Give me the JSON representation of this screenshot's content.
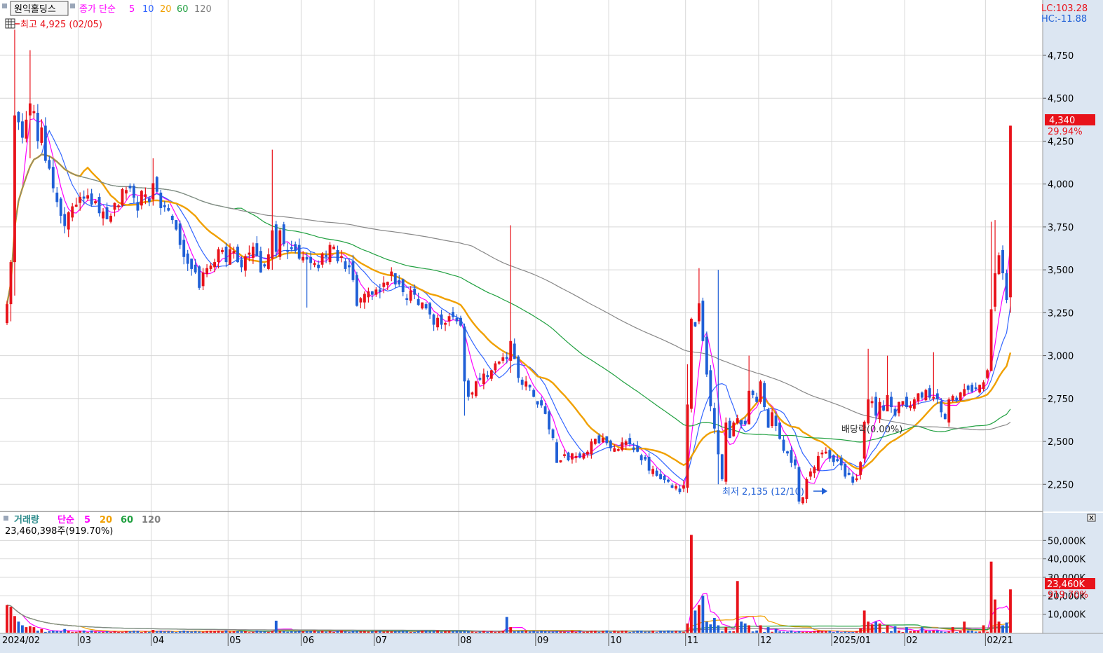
{
  "price_legend": {
    "stock_name": "원익홀딩스",
    "series_label": "종가 단순",
    "ma": [
      {
        "label": "5",
        "color": "#ff00ff"
      },
      {
        "label": "10",
        "color": "#3366ff"
      },
      {
        "label": "20",
        "color": "#f0a000"
      },
      {
        "label": "60",
        "color": "#20a040"
      },
      {
        "label": "120",
        "color": "#808080"
      }
    ],
    "high_note": "최고 4,925 (02/05)",
    "low_note": "최저 2,135 (12/10)",
    "dividend_note": "배당락(0.00%)"
  },
  "corner": {
    "lc": "LC:103.28",
    "hc": "HC:-11.88"
  },
  "last_price": {
    "value": "4,340",
    "change": "29.94%"
  },
  "volume_legend": {
    "title": "거래량",
    "series_label": "단순",
    "ma": [
      {
        "label": "5",
        "color": "#ff00ff"
      },
      {
        "label": "20",
        "color": "#f0a000"
      },
      {
        "label": "60",
        "color": "#20a040"
      },
      {
        "label": "120",
        "color": "#808080"
      }
    ],
    "total": "23,460,398주(919.70%)"
  },
  "last_volume": {
    "value": "23,460K",
    "change": "919.70%"
  },
  "colors": {
    "up": "#e8121a",
    "down": "#1f5fd6",
    "axis_bg": "#dce6f2",
    "grid": "#d8d8d8"
  },
  "chart_data": [
    {
      "type": "candlestick",
      "title": "",
      "ylim": [
        2100,
        4950
      ],
      "yticks": [
        2250,
        2500,
        2750,
        3000,
        3250,
        3500,
        3750,
        4000,
        4250,
        4500,
        4750
      ],
      "ytick_labels": [
        "2,250",
        "2,500",
        "2,750",
        "3,000",
        "3,250",
        "3,500",
        "3,750",
        "4,000",
        "4,250",
        "4,500",
        "4,750"
      ],
      "x_labels": [
        "2024/02",
        "03",
        "04",
        "05",
        "06",
        "07",
        "08",
        "09",
        "10",
        "11",
        "12",
        "2025/01",
        "02",
        "02/21"
      ],
      "x_label_index": [
        0,
        19,
        38,
        58,
        77,
        96,
        118,
        138,
        157,
        177,
        196,
        215,
        234,
        255
      ],
      "anchors_close": [
        [
          0,
          3300
        ],
        [
          1,
          3550
        ],
        [
          2,
          4450
        ],
        [
          4,
          4300
        ],
        [
          6,
          4500
        ],
        [
          7,
          4400
        ],
        [
          8,
          4300
        ],
        [
          9,
          4380
        ],
        [
          10,
          4150
        ],
        [
          12,
          4000
        ],
        [
          14,
          3800
        ],
        [
          15,
          3780
        ],
        [
          17,
          3880
        ],
        [
          19,
          3880
        ],
        [
          20,
          3930
        ],
        [
          21,
          3950
        ],
        [
          23,
          3870
        ],
        [
          25,
          3830
        ],
        [
          27,
          3800
        ],
        [
          28,
          3880
        ],
        [
          31,
          3950
        ],
        [
          33,
          3920
        ],
        [
          34,
          3880
        ],
        [
          35,
          3920
        ],
        [
          37,
          3900
        ],
        [
          38,
          4000
        ],
        [
          39,
          3980
        ],
        [
          40,
          3900
        ],
        [
          42,
          3870
        ],
        [
          43,
          3800
        ],
        [
          45,
          3670
        ],
        [
          46,
          3550
        ],
        [
          48,
          3500
        ],
        [
          50,
          3430
        ],
        [
          52,
          3500
        ],
        [
          54,
          3580
        ],
        [
          56,
          3600
        ],
        [
          57,
          3580
        ],
        [
          59,
          3600
        ],
        [
          61,
          3550
        ],
        [
          62,
          3570
        ],
        [
          64,
          3600
        ],
        [
          65,
          3540
        ],
        [
          67,
          3500
        ],
        [
          68,
          3620
        ],
        [
          69,
          3700
        ],
        [
          70,
          3650
        ],
        [
          71,
          3720
        ],
        [
          72,
          3670
        ],
        [
          74,
          3600
        ],
        [
          76,
          3560
        ],
        [
          78,
          3520
        ],
        [
          80,
          3530
        ],
        [
          82,
          3560
        ],
        [
          84,
          3640
        ],
        [
          85,
          3620
        ],
        [
          86,
          3580
        ],
        [
          88,
          3520
        ],
        [
          90,
          3450
        ],
        [
          91,
          3300
        ],
        [
          92,
          3320
        ],
        [
          94,
          3400
        ],
        [
          96,
          3370
        ],
        [
          98,
          3420
        ],
        [
          100,
          3460
        ],
        [
          101,
          3420
        ],
        [
          102,
          3380
        ],
        [
          104,
          3360
        ],
        [
          106,
          3350
        ],
        [
          108,
          3320
        ],
        [
          110,
          3230
        ],
        [
          112,
          3200
        ],
        [
          114,
          3200
        ],
        [
          116,
          3230
        ],
        [
          118,
          3160
        ],
        [
          119,
          2850
        ],
        [
          120,
          2780
        ],
        [
          122,
          2820
        ],
        [
          124,
          2880
        ],
        [
          126,
          2930
        ],
        [
          128,
          2970
        ],
        [
          130,
          3000
        ],
        [
          131,
          3100
        ],
        [
          132,
          2950
        ],
        [
          134,
          2850
        ],
        [
          136,
          2820
        ],
        [
          137,
          2760
        ],
        [
          138,
          2720
        ],
        [
          140,
          2650
        ],
        [
          142,
          2500
        ],
        [
          143,
          2400
        ],
        [
          145,
          2420
        ],
        [
          147,
          2400
        ],
        [
          149,
          2420
        ],
        [
          151,
          2450
        ],
        [
          153,
          2500
        ],
        [
          155,
          2520
        ],
        [
          157,
          2460
        ],
        [
          159,
          2480
        ],
        [
          161,
          2470
        ],
        [
          163,
          2450
        ],
        [
          165,
          2400
        ],
        [
          167,
          2350
        ],
        [
          169,
          2300
        ],
        [
          171,
          2260
        ],
        [
          173,
          2240
        ],
        [
          175,
          2230
        ],
        [
          176,
          2220
        ],
        [
          177,
          2700
        ],
        [
          178,
          3200
        ],
        [
          179,
          3150
        ],
        [
          180,
          3300
        ],
        [
          181,
          3100
        ],
        [
          182,
          2900
        ],
        [
          183,
          2700
        ],
        [
          184,
          2600
        ],
        [
          185,
          2400
        ],
        [
          186,
          2300
        ],
        [
          187,
          2600
        ],
        [
          188,
          2550
        ],
        [
          190,
          2650
        ],
        [
          192,
          2600
        ],
        [
          193,
          2800
        ],
        [
          195,
          2750
        ],
        [
          196,
          2850
        ],
        [
          197,
          2700
        ],
        [
          198,
          2600
        ],
        [
          199,
          2640
        ],
        [
          201,
          2500
        ],
        [
          203,
          2420
        ],
        [
          205,
          2350
        ],
        [
          206,
          2150
        ],
        [
          207,
          2180
        ],
        [
          208,
          2270
        ],
        [
          209,
          2310
        ],
        [
          211,
          2400
        ],
        [
          213,
          2430
        ],
        [
          215,
          2400
        ],
        [
          217,
          2350
        ],
        [
          218,
          2310
        ],
        [
          219,
          2290
        ],
        [
          220,
          2270
        ],
        [
          221,
          2300
        ],
        [
          222,
          2380
        ],
        [
          223,
          2610
        ],
        [
          224,
          2720
        ],
        [
          225,
          2760
        ],
        [
          226,
          2680
        ],
        [
          227,
          2740
        ],
        [
          228,
          2700
        ],
        [
          229,
          2800
        ],
        [
          230,
          2720
        ],
        [
          231,
          2680
        ],
        [
          233,
          2720
        ],
        [
          235,
          2730
        ],
        [
          237,
          2760
        ],
        [
          239,
          2780
        ],
        [
          240,
          2750
        ],
        [
          242,
          2770
        ],
        [
          243,
          2650
        ],
        [
          244,
          2640
        ],
        [
          245,
          2720
        ],
        [
          247,
          2760
        ],
        [
          249,
          2820
        ],
        [
          250,
          2800
        ],
        [
          252,
          2810
        ],
        [
          254,
          2830
        ],
        [
          255,
          2900
        ],
        [
          256,
          3300
        ],
        [
          257,
          3500
        ],
        [
          258,
          3580
        ],
        [
          259,
          3500
        ],
        [
          260,
          3340
        ],
        [
          261,
          4340
        ]
      ],
      "high_low_overrides": [
        [
          1,
          null,
          3200
        ],
        [
          2,
          4900,
          3350
        ],
        [
          6,
          4780,
          4150
        ],
        [
          38,
          4150,
          null
        ],
        [
          69,
          4200,
          3500
        ],
        [
          78,
          null,
          3280
        ],
        [
          119,
          null,
          2650
        ],
        [
          131,
          3760,
          2900
        ],
        [
          177,
          2950,
          2200
        ],
        [
          180,
          3510,
          null
        ],
        [
          185,
          3500,
          2250
        ],
        [
          193,
          3000,
          null
        ],
        [
          206,
          null,
          2135
        ],
        [
          224,
          3040,
          null
        ],
        [
          229,
          3000,
          2680
        ],
        [
          241,
          3020,
          null
        ],
        [
          256,
          3780,
          3150
        ],
        [
          257,
          3790,
          null
        ],
        [
          261,
          4340,
          3250
        ]
      ],
      "ma_series": [
        "5",
        "10",
        "20",
        "60",
        "120"
      ]
    },
    {
      "type": "bar",
      "title": "",
      "ylim": [
        0,
        60000
      ],
      "yticks": [
        10000,
        20000,
        30000,
        40000,
        50000
      ],
      "ytick_labels": [
        "10,000K",
        "20,000K",
        "30,000K",
        "40,000K",
        "50,000K"
      ],
      "unit": "K",
      "spikes": [
        [
          0,
          15000
        ],
        [
          1,
          14000
        ],
        [
          2,
          9000
        ],
        [
          3,
          6000
        ],
        [
          4,
          4000
        ],
        [
          5,
          3000
        ],
        [
          6,
          3500
        ],
        [
          7,
          3000
        ],
        [
          9,
          2000
        ],
        [
          15,
          2000
        ],
        [
          38,
          1500
        ],
        [
          70,
          6500
        ],
        [
          82,
          1000
        ],
        [
          112,
          1200
        ],
        [
          130,
          8500
        ],
        [
          131,
          3000
        ],
        [
          177,
          5000
        ],
        [
          178,
          53000
        ],
        [
          179,
          12000
        ],
        [
          180,
          15000
        ],
        [
          181,
          20000
        ],
        [
          182,
          6000
        ],
        [
          183,
          4500
        ],
        [
          184,
          8000
        ],
        [
          185,
          4000
        ],
        [
          187,
          3000
        ],
        [
          190,
          28000
        ],
        [
          191,
          6000
        ],
        [
          192,
          5000
        ],
        [
          193,
          4000
        ],
        [
          196,
          4000
        ],
        [
          198,
          3000
        ],
        [
          200,
          2000
        ],
        [
          222,
          2500
        ],
        [
          223,
          12000
        ],
        [
          224,
          6000
        ],
        [
          225,
          4500
        ],
        [
          226,
          6000
        ],
        [
          227,
          5000
        ],
        [
          229,
          4000
        ],
        [
          231,
          3500
        ],
        [
          234,
          3000
        ],
        [
          238,
          3000
        ],
        [
          246,
          3000
        ],
        [
          249,
          6000
        ],
        [
          254,
          4000
        ],
        [
          256,
          38500
        ],
        [
          257,
          18000
        ],
        [
          258,
          6000
        ],
        [
          259,
          4000
        ],
        [
          260,
          5500
        ],
        [
          261,
          23460
        ]
      ],
      "ma_series": [
        "5",
        "20",
        "60",
        "120"
      ]
    }
  ]
}
